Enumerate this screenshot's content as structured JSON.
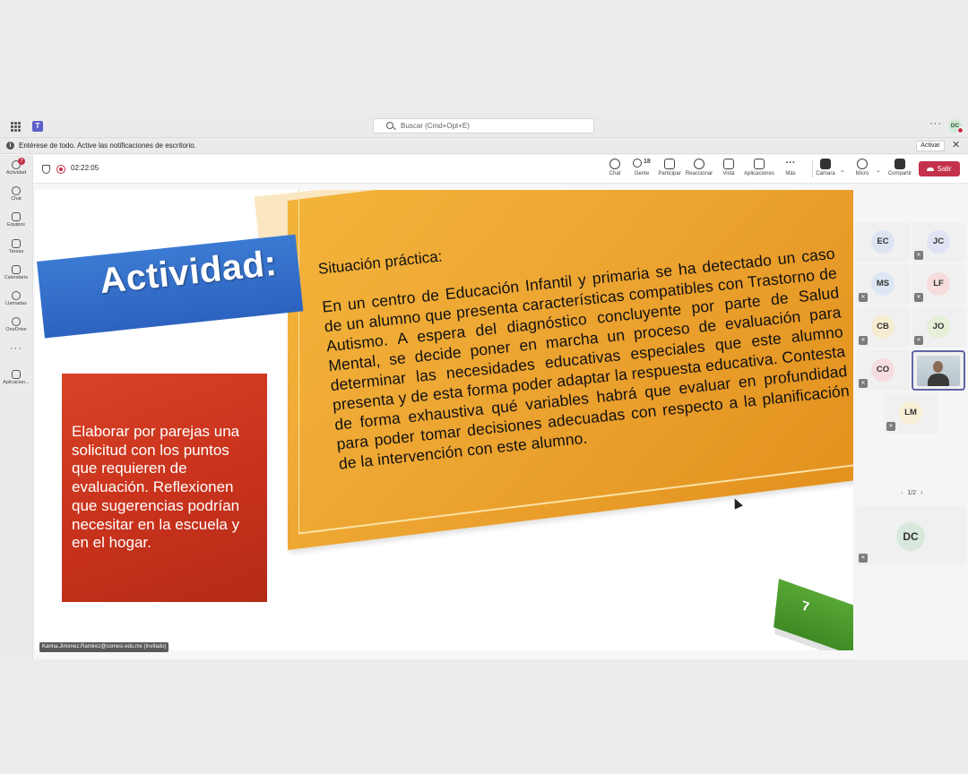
{
  "topbar": {
    "search_placeholder": "Buscar (Cmd+Opt+E)",
    "more": "···",
    "user_initials": "DC"
  },
  "notification": {
    "message": "Entérese de todo. Active las notificaciones de escritorio.",
    "activate_label": "Activar",
    "close": "✕"
  },
  "rail": {
    "items": [
      {
        "label": "Actividad",
        "badge": "7"
      },
      {
        "label": "Chat"
      },
      {
        "label": "Equipos"
      },
      {
        "label": "Tareas"
      },
      {
        "label": "Calendario"
      },
      {
        "label": "Llamadas"
      },
      {
        "label": "OneDrive"
      },
      {
        "label": "Aplicacion..."
      }
    ],
    "more": "···"
  },
  "meeting": {
    "timer": "02:22:05",
    "controls": {
      "chat": "Chat",
      "people": "Gente",
      "people_count": "18",
      "raise": "Participar",
      "react": "Reaccionar",
      "view": "Vista",
      "apps": "Aplicaciones",
      "more": "Más",
      "camera": "Cámara",
      "mic": "Micro",
      "share": "Compartir",
      "leave": "Salir"
    }
  },
  "slide": {
    "heading": "Actividad:",
    "subtitle": "Situación práctica:",
    "paragraph": "En un centro de Educación Infantil y primaria se ha detectado un caso de un alumno que presenta características compatibles con Trastorno de Autismo. A espera del diagnóstico concluyente por parte de Salud Mental, se decide poner en marcha un proceso de evaluación para determinar las necesidades educativas especiales que este alumno presenta y de esta forma poder adaptar la respuesta educativa. Contesta de forma exhaustiva qué variables habrá que evaluar en profundidad para poder tomar decisiones adecuadas con respecto a la planificación de la intervención con este alumno.",
    "task": "Elaborar por parejas una solicitud con los puntos que requieren de evaluación. Reflexionen que sugerencias podrían necesitar en la escuela y en el hogar.",
    "page_number": "7"
  },
  "presenter_label": "Karina.Jimenez.Ramirez@comesi.edu.mx (Invitado)",
  "participants": [
    {
      "initials": "EC",
      "color": "#dce4f2",
      "muted": false
    },
    {
      "initials": "JC",
      "color": "#dfe3f3",
      "muted": true
    },
    {
      "initials": "MS",
      "color": "#dde6f4",
      "muted": true
    },
    {
      "initials": "LF",
      "color": "#f6dcdc",
      "muted": true
    },
    {
      "initials": "CB",
      "color": "#f5ecd2",
      "muted": true
    },
    {
      "initials": "JO",
      "color": "#e6efd8",
      "muted": true
    },
    {
      "initials": "CO",
      "color": "#f6dcdf",
      "muted": true
    },
    {
      "initials": "LM",
      "color": "#f6efd6",
      "muted": true
    }
  ],
  "pager": {
    "prev": "‹",
    "label": "1/2",
    "next": "›"
  },
  "self_tile": {
    "initials": "DC",
    "color": "#d9e8dc"
  }
}
